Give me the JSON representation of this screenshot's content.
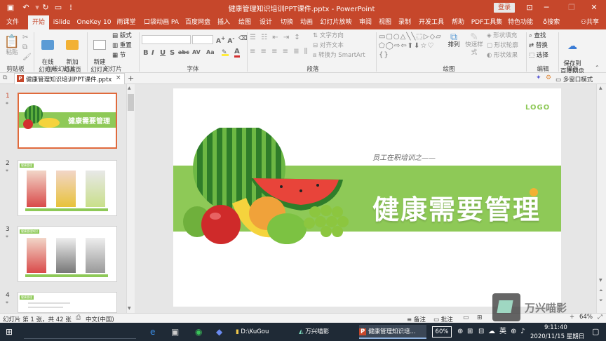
{
  "window": {
    "title": "健康管理知识培训PPT课件.pptx  -  PowerPoint",
    "login": "登录",
    "accent": "#c6472b"
  },
  "tabs": [
    "文件",
    "开始",
    "iSlide",
    "OneKey 10",
    "雨课堂",
    "口袋动画 PA",
    "百度网盘",
    "插入",
    "绘图",
    "设计",
    "切换",
    "动画",
    "幻灯片放映",
    "审阅",
    "视图",
    "录制",
    "开发工具",
    "帮助",
    "PDF工具集",
    "特色功能"
  ],
  "tell_me": "搜索",
  "share": "共享",
  "ribbon": {
    "clipboard": {
      "paste": "粘贴",
      "label": "剪贴板"
    },
    "online": {
      "btn1": "在线\n幻灯片",
      "btn2": "新加\n动画页",
      "label": "在线幻灯片"
    },
    "slides": {
      "new": "新建\n幻灯片",
      "layout": "版式",
      "reset": "重置",
      "section": "节",
      "label": "幻灯片"
    },
    "font": {
      "label": "字体",
      "bold": "B",
      "italic": "I",
      "underline": "U",
      "strike": "S",
      "shadow": "abc",
      "spacing": "AV",
      "case": "Aa"
    },
    "paragraph": {
      "label": "段落",
      "text_dir": "文字方向",
      "align_text": "对齐文本",
      "smartart": "转换为 SmartArt"
    },
    "drawing": {
      "label": "绘图",
      "arrange": "排列",
      "quick_styles": "快速样式",
      "fill": "形状填充",
      "outline": "形状轮廓",
      "effects": "形状效果"
    },
    "editing": {
      "label": "编辑",
      "find": "查找",
      "replace": "替换",
      "select": "选择"
    },
    "save": {
      "label": "保存",
      "btn": "保存到\n百度网盘"
    }
  },
  "file_tab": {
    "name": "健康管理知识培训PPT课件.pptx",
    "multi_window": "多窗口模式"
  },
  "slides": [
    {
      "num": "1",
      "title": "健康需要管理"
    },
    {
      "num": "2",
      "badge": "健康管理",
      "caption": "健康管理知识"
    },
    {
      "num": "3",
      "badge": "健康管理知识"
    },
    {
      "num": "4",
      "badge": "健康管理"
    }
  ],
  "slide": {
    "logo": "LOGO",
    "subtitle": "员工在职培训之——",
    "title": "健康需要管理",
    "green": "#8ec957"
  },
  "status": {
    "slide_info": "幻灯片 第 1 张，共 42 张",
    "lang": "中文(中国)",
    "notes": "备注",
    "comments": "批注",
    "zoom": "64%"
  },
  "taskbar": {
    "items": [
      "D:\\KuGou",
      "万兴喵影",
      "健康管理知识培..."
    ],
    "battery": "60%",
    "ime": "英",
    "time": "9:11:40",
    "date": "2020/11/15 星期日"
  },
  "watermark": "万兴喵影"
}
